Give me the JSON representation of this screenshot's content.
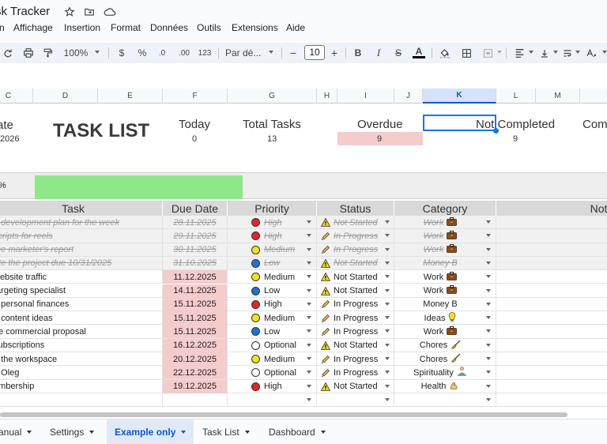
{
  "window": {
    "title": "sk Tracker"
  },
  "menu": [
    "n",
    "Affichage",
    "Insertion",
    "Format",
    "Données",
    "Outils",
    "Extensions",
    "Aide"
  ],
  "toolbar": {
    "zoom": "100%",
    "currency": "$",
    "percent": "%",
    "dec_minus": ".0",
    "dec_plus": ".00",
    "format123": "123",
    "font": "Par dé...",
    "font_size": "10",
    "minus": "−",
    "plus": "+",
    "bold": "B",
    "italic": "I",
    "strike": "S",
    "textcolor": "A"
  },
  "columns": [
    "C",
    "D",
    "E",
    "F",
    "G",
    "H",
    "I",
    "J",
    "K",
    "L",
    "M"
  ],
  "selected_column": "K",
  "summary": {
    "date_label": "ate",
    "date_value": "2026",
    "task_list": "TASK LIST",
    "today_label": "Today",
    "today_value": "0",
    "total_label": "Total Tasks",
    "total_value": "13",
    "overdue_label": "Overdue",
    "overdue_value": "9",
    "not_completed_label": "Not Completed",
    "not_completed_value": "9",
    "completed_label": "Com"
  },
  "progress": {
    "label": "%",
    "fraction": 0.35
  },
  "table": {
    "headers": {
      "task": "Task",
      "due": "Due Date",
      "priority": "Priority",
      "status": "Status",
      "category": "Category",
      "notes": "Not"
    },
    "rows": [
      {
        "task": "e development plan for the week",
        "due": "28.11.2025",
        "priority": "High",
        "status": "Not Started",
        "category": "Work",
        "done": true,
        "due_hl": false
      },
      {
        "task": "scripts for reels",
        "due": "29.11.2025",
        "priority": "High",
        "status": "In Progress",
        "category": "Work",
        "done": true,
        "due_hl": false
      },
      {
        "task": "the marketer's report",
        "due": "30.11.2025",
        "priority": "Medium",
        "status": "In Progress",
        "category": "Work",
        "done": true,
        "due_hl": false
      },
      {
        "task": "ate the project due 10/31/2025",
        "due": "31.10.2025",
        "priority": "Low",
        "status": "Not Started",
        "category": "Money B",
        "done": true,
        "due_hl": false
      },
      {
        "task": "website traffic",
        "due": "11.12.2025",
        "priority": "Medium",
        "status": "Not Started",
        "category": "Work",
        "done": false,
        "due_hl": true
      },
      {
        "task": "targeting specialist",
        "due": "14.11.2025",
        "priority": "Low",
        "status": "Not Started",
        "category": "Work",
        "done": false,
        "due_hl": true
      },
      {
        "task": "e personal finances",
        "due": "15.11.2025",
        "priority": "High",
        "status": "In Progress",
        "category": "Money B",
        "done": false,
        "due_hl": true
      },
      {
        "task": "0 content ideas",
        "due": "15.11.2025",
        "priority": "Medium",
        "status": "In Progress",
        "category": "Ideas",
        "done": false,
        "due_hl": true
      },
      {
        "task": "he commercial proposal",
        "due": "15.11.2025",
        "priority": "Low",
        "status": "In Progress",
        "category": "Work",
        "done": false,
        "due_hl": true
      },
      {
        "task": "subscriptions",
        "due": "16.12.2025",
        "priority": "Optional",
        "status": "Not Started",
        "category": "Chores",
        "done": false,
        "due_hl": true
      },
      {
        "task": "e the workspace",
        "due": "20.12.2025",
        "priority": "Medium",
        "status": "In Progress",
        "category": "Chores",
        "done": false,
        "due_hl": true
      },
      {
        "task": "n Oleg",
        "due": "22.12.2025",
        "priority": "Optional",
        "status": "In Progress",
        "category": "Spirituality",
        "done": false,
        "due_hl": true
      },
      {
        "task": "embership",
        "due": "19.12.2025",
        "priority": "High",
        "status": "Not Started",
        "category": "Health",
        "done": false,
        "due_hl": true
      }
    ]
  },
  "priority_colors": {
    "High": "#e0262b",
    "Medium": "#f5e21d",
    "Low": "#1e73d2",
    "Optional": "#ffffff"
  },
  "category_icons": {
    "Work": "briefcase-icon",
    "Money B": "",
    "Ideas": "lightbulb-icon",
    "Chores": "broom-icon",
    "Spirituality": "meditation-icon",
    "Health": "muscle-icon"
  },
  "sheets": [
    {
      "label": "anual",
      "active": false
    },
    {
      "label": "Settings",
      "active": false
    },
    {
      "label": "Example only",
      "active": true
    },
    {
      "label": "Task List",
      "active": false
    },
    {
      "label": "Dashboard",
      "active": false
    }
  ]
}
